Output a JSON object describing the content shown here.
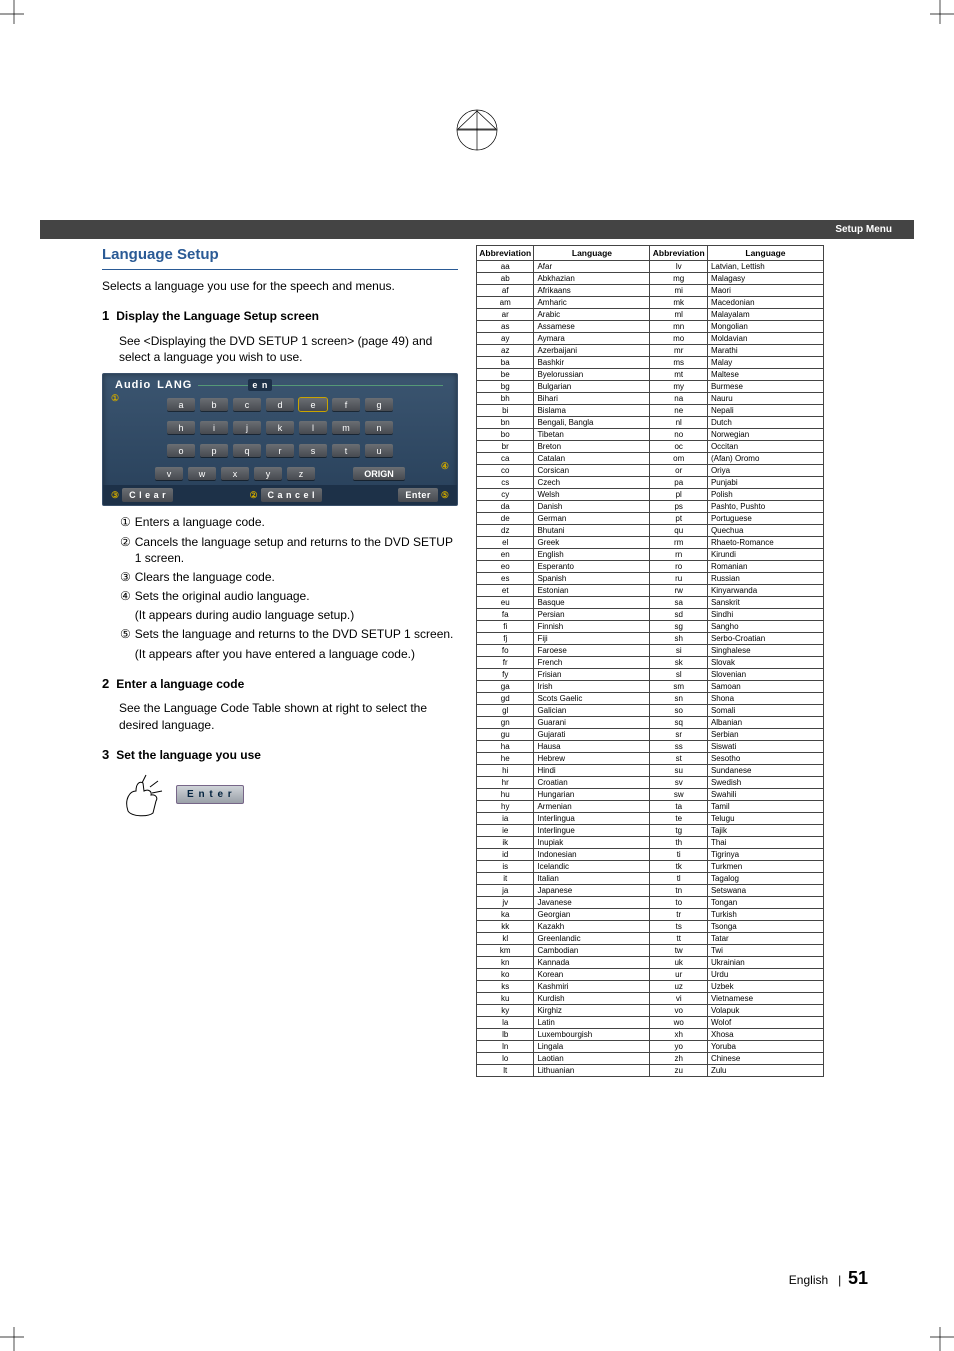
{
  "setupBar": "Setup Menu",
  "sectionTitle": "Language Setup",
  "intro": "Selects a language you use for the speech and menus.",
  "step1": {
    "num": "1",
    "title": "Display the Language Setup screen",
    "body": "See <Displaying the DVD SETUP 1 screen> (page 49) and select a language you wish to use."
  },
  "panel": {
    "header": "Audio",
    "tag": "LANG",
    "enLabel": "e n",
    "rows": [
      [
        "a",
        "b",
        "c",
        "d",
        "e",
        "f",
        "g"
      ],
      [
        "h",
        "i",
        "j",
        "k",
        "l",
        "m",
        "n"
      ],
      [
        "o",
        "p",
        "q",
        "r",
        "s",
        "t",
        "u"
      ],
      [
        "v",
        "w",
        "x",
        "y",
        "z"
      ]
    ],
    "orign": "ORIGN",
    "footClear": "C l e a r",
    "footCancel": "C a n c e l",
    "footEnter": "Enter"
  },
  "notes": [
    {
      "k": "①",
      "t": "Enters a language code."
    },
    {
      "k": "②",
      "t": "Cancels the language setup and returns to the DVD SETUP 1 screen."
    },
    {
      "k": "③",
      "t": "Clears the language code."
    },
    {
      "k": "④",
      "t": "Sets the original audio language."
    },
    {
      "k": "④b",
      "t": "(It appears during audio language setup.)"
    },
    {
      "k": "⑤",
      "t": "Sets the language and returns to the DVD SETUP 1 screen."
    },
    {
      "k": "⑤b",
      "t": "(It appears after you have entered a language code.)"
    }
  ],
  "step2": {
    "num": "2",
    "title": "Enter a language code",
    "body": "See the Language Code Table shown at right to select the desired language."
  },
  "step3": {
    "num": "3",
    "title": "Set the language you use"
  },
  "enterBtn": "E n t e r",
  "tableHead": {
    "a": "Abbreviation",
    "b": "Language"
  },
  "langs": [
    [
      "aa",
      "Afar",
      "lv",
      "Latvian, Lettish"
    ],
    [
      "ab",
      "Abkhazian",
      "mg",
      "Malagasy"
    ],
    [
      "af",
      "Afrikaans",
      "mi",
      "Maori"
    ],
    [
      "am",
      "Amharic",
      "mk",
      "Macedonian"
    ],
    [
      "ar",
      "Arabic",
      "ml",
      "Malayalam"
    ],
    [
      "as",
      "Assamese",
      "mn",
      "Mongolian"
    ],
    [
      "ay",
      "Aymara",
      "mo",
      "Moldavian"
    ],
    [
      "az",
      "Azerbaijani",
      "mr",
      "Marathi"
    ],
    [
      "ba",
      "Bashkir",
      "ms",
      "Malay"
    ],
    [
      "be",
      "Byelorussian",
      "mt",
      "Maltese"
    ],
    [
      "bg",
      "Bulgarian",
      "my",
      "Burmese"
    ],
    [
      "bh",
      "Bihari",
      "na",
      "Nauru"
    ],
    [
      "bi",
      "Bislama",
      "ne",
      "Nepali"
    ],
    [
      "bn",
      "Bengali, Bangla",
      "nl",
      "Dutch"
    ],
    [
      "bo",
      "Tibetan",
      "no",
      "Norwegian"
    ],
    [
      "br",
      "Breton",
      "oc",
      "Occitan"
    ],
    [
      "ca",
      "Catalan",
      "om",
      "(Afan) Oromo"
    ],
    [
      "co",
      "Corsican",
      "or",
      "Oriya"
    ],
    [
      "cs",
      "Czech",
      "pa",
      "Punjabi"
    ],
    [
      "cy",
      "Welsh",
      "pl",
      "Polish"
    ],
    [
      "da",
      "Danish",
      "ps",
      "Pashto, Pushto"
    ],
    [
      "de",
      "German",
      "pt",
      "Portuguese"
    ],
    [
      "dz",
      "Bhutani",
      "qu",
      "Quechua"
    ],
    [
      "el",
      "Greek",
      "rm",
      "Rhaeto-Romance"
    ],
    [
      "en",
      "English",
      "rn",
      "Kirundi"
    ],
    [
      "eo",
      "Esperanto",
      "ro",
      "Romanian"
    ],
    [
      "es",
      "Spanish",
      "ru",
      "Russian"
    ],
    [
      "et",
      "Estonian",
      "rw",
      "Kinyarwanda"
    ],
    [
      "eu",
      "Basque",
      "sa",
      "Sanskrit"
    ],
    [
      "fa",
      "Persian",
      "sd",
      "Sindhi"
    ],
    [
      "fi",
      "Finnish",
      "sg",
      "Sangho"
    ],
    [
      "fj",
      "Fiji",
      "sh",
      "Serbo-Croatian"
    ],
    [
      "fo",
      "Faroese",
      "si",
      "Singhalese"
    ],
    [
      "fr",
      "French",
      "sk",
      "Slovak"
    ],
    [
      "fy",
      "Frisian",
      "sl",
      "Slovenian"
    ],
    [
      "ga",
      "Irish",
      "sm",
      "Samoan"
    ],
    [
      "gd",
      "Scots Gaelic",
      "sn",
      "Shona"
    ],
    [
      "gl",
      "Galician",
      "so",
      "Somali"
    ],
    [
      "gn",
      "Guarani",
      "sq",
      "Albanian"
    ],
    [
      "gu",
      "Gujarati",
      "sr",
      "Serbian"
    ],
    [
      "ha",
      "Hausa",
      "ss",
      "Siswati"
    ],
    [
      "he",
      "Hebrew",
      "st",
      "Sesotho"
    ],
    [
      "hi",
      "Hindi",
      "su",
      "Sundanese"
    ],
    [
      "hr",
      "Croatian",
      "sv",
      "Swedish"
    ],
    [
      "hu",
      "Hungarian",
      "sw",
      "Swahili"
    ],
    [
      "hy",
      "Armenian",
      "ta",
      "Tamil"
    ],
    [
      "ia",
      "Interlingua",
      "te",
      "Telugu"
    ],
    [
      "ie",
      "Interlingue",
      "tg",
      "Tajik"
    ],
    [
      "ik",
      "Inupiak",
      "th",
      "Thai"
    ],
    [
      "id",
      "Indonesian",
      "ti",
      "Tigrinya"
    ],
    [
      "is",
      "Icelandic",
      "tk",
      "Turkmen"
    ],
    [
      "it",
      "Italian",
      "tl",
      "Tagalog"
    ],
    [
      "ja",
      "Japanese",
      "tn",
      "Setswana"
    ],
    [
      "jv",
      "Javanese",
      "to",
      "Tongan"
    ],
    [
      "ka",
      "Georgian",
      "tr",
      "Turkish"
    ],
    [
      "kk",
      "Kazakh",
      "ts",
      "Tsonga"
    ],
    [
      "kl",
      "Greenlandic",
      "tt",
      "Tatar"
    ],
    [
      "km",
      "Cambodian",
      "tw",
      "Twi"
    ],
    [
      "kn",
      "Kannada",
      "uk",
      "Ukrainian"
    ],
    [
      "ko",
      "Korean",
      "ur",
      "Urdu"
    ],
    [
      "ks",
      "Kashmiri",
      "uz",
      "Uzbek"
    ],
    [
      "ku",
      "Kurdish",
      "vi",
      "Vietnamese"
    ],
    [
      "ky",
      "Kirghiz",
      "vo",
      "Volapuk"
    ],
    [
      "la",
      "Latin",
      "wo",
      "Wolof"
    ],
    [
      "lb",
      "Luxembourgish",
      "xh",
      "Xhosa"
    ],
    [
      "ln",
      "Lingala",
      "yo",
      "Yoruba"
    ],
    [
      "lo",
      "Laotian",
      "zh",
      "Chinese"
    ],
    [
      "lt",
      "Lithuanian",
      "zu",
      "Zulu"
    ]
  ],
  "footer": {
    "lang": "English",
    "sep": "|",
    "page": "51"
  }
}
